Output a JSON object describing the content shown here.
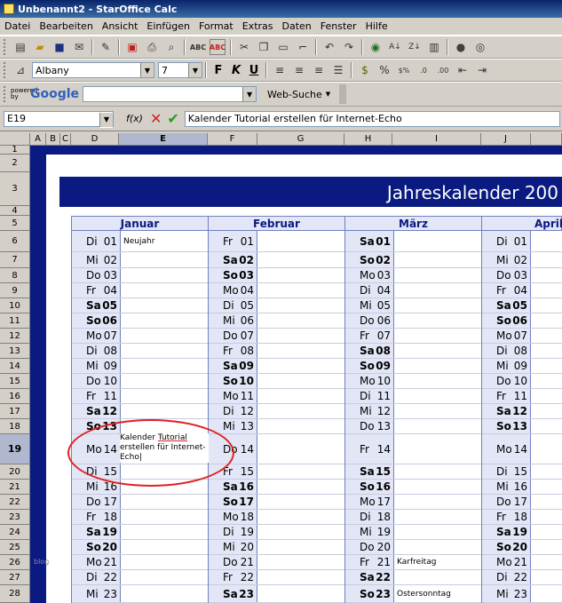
{
  "window": {
    "title": "Unbenannt2 - StarOffice Calc"
  },
  "menu": [
    "Datei",
    "Bearbeiten",
    "Ansicht",
    "Einfügen",
    "Format",
    "Extras",
    "Daten",
    "Fenster",
    "Hilfe"
  ],
  "font": {
    "name": "Albany",
    "size": "7"
  },
  "google": {
    "powered": "powered by",
    "logo": "Google",
    "search_value": "",
    "search_button": "Web-Suche"
  },
  "formula": {
    "namebox": "E19",
    "fx": "f(x)",
    "content": "Kalender Tutorial erstellen für Internet-Echo"
  },
  "columns": [
    "A",
    "B",
    "C",
    "D",
    "E",
    "F",
    "G",
    "H",
    "I",
    "J"
  ],
  "rows": [
    "1",
    "2",
    "3",
    "4",
    "5",
    "6",
    "7",
    "8",
    "9",
    "10",
    "11",
    "12",
    "13",
    "14",
    "15",
    "16",
    "17",
    "18",
    "19",
    "20",
    "21",
    "22",
    "23",
    "24",
    "25",
    "26",
    "27",
    "28"
  ],
  "calendar": {
    "title": "Jahreskalender 200",
    "months": [
      "Januar",
      "Februar",
      "März",
      "April"
    ],
    "januar": [
      [
        "Di",
        "01",
        "Neujahr"
      ],
      [
        "Mi",
        "02",
        ""
      ],
      [
        "Do",
        "03",
        ""
      ],
      [
        "Fr",
        "04",
        ""
      ],
      [
        "Sa",
        "05",
        ""
      ],
      [
        "So",
        "06",
        ""
      ],
      [
        "Mo",
        "07",
        ""
      ],
      [
        "Di",
        "08",
        ""
      ],
      [
        "Mi",
        "09",
        ""
      ],
      [
        "Do",
        "10",
        ""
      ],
      [
        "Fr",
        "11",
        ""
      ],
      [
        "Sa",
        "12",
        ""
      ],
      [
        "So",
        "13",
        ""
      ],
      [
        "Mo",
        "14",
        ""
      ],
      [
        "Di",
        "15",
        ""
      ],
      [
        "Mi",
        "16",
        ""
      ],
      [
        "Do",
        "17",
        ""
      ],
      [
        "Fr",
        "18",
        ""
      ],
      [
        "Sa",
        "19",
        ""
      ],
      [
        "So",
        "20",
        ""
      ],
      [
        "Mo",
        "21",
        ""
      ],
      [
        "Di",
        "22",
        ""
      ],
      [
        "Mi",
        "23",
        ""
      ]
    ],
    "februar": [
      [
        "Fr",
        "01",
        ""
      ],
      [
        "Sa",
        "02",
        ""
      ],
      [
        "So",
        "03",
        ""
      ],
      [
        "Mo",
        "04",
        ""
      ],
      [
        "Di",
        "05",
        ""
      ],
      [
        "Mi",
        "06",
        ""
      ],
      [
        "Do",
        "07",
        ""
      ],
      [
        "Fr",
        "08",
        ""
      ],
      [
        "Sa",
        "09",
        ""
      ],
      [
        "So",
        "10",
        ""
      ],
      [
        "Mo",
        "11",
        ""
      ],
      [
        "Di",
        "12",
        ""
      ],
      [
        "Mi",
        "13",
        ""
      ],
      [
        "Do",
        "14",
        ""
      ],
      [
        "Fr",
        "15",
        ""
      ],
      [
        "Sa",
        "16",
        ""
      ],
      [
        "So",
        "17",
        ""
      ],
      [
        "Mo",
        "18",
        ""
      ],
      [
        "Di",
        "19",
        ""
      ],
      [
        "Mi",
        "20",
        ""
      ],
      [
        "Do",
        "21",
        ""
      ],
      [
        "Fr",
        "22",
        ""
      ],
      [
        "Sa",
        "23",
        ""
      ]
    ],
    "maerz": [
      [
        "Sa",
        "01",
        ""
      ],
      [
        "So",
        "02",
        ""
      ],
      [
        "Mo",
        "03",
        ""
      ],
      [
        "Di",
        "04",
        ""
      ],
      [
        "Mi",
        "05",
        ""
      ],
      [
        "Do",
        "06",
        ""
      ],
      [
        "Fr",
        "07",
        ""
      ],
      [
        "Sa",
        "08",
        ""
      ],
      [
        "So",
        "09",
        ""
      ],
      [
        "Mo",
        "10",
        ""
      ],
      [
        "Di",
        "11",
        ""
      ],
      [
        "Mi",
        "12",
        ""
      ],
      [
        "Do",
        "13",
        ""
      ],
      [
        "Fr",
        "14",
        ""
      ],
      [
        "Sa",
        "15",
        ""
      ],
      [
        "So",
        "16",
        ""
      ],
      [
        "Mo",
        "17",
        ""
      ],
      [
        "Di",
        "18",
        ""
      ],
      [
        "Mi",
        "19",
        ""
      ],
      [
        "Do",
        "20",
        ""
      ],
      [
        "Fr",
        "21",
        "Karfreitag"
      ],
      [
        "Sa",
        "22",
        ""
      ],
      [
        "So",
        "23",
        "Ostersonntag"
      ]
    ],
    "april": [
      [
        "Di",
        "01",
        ""
      ],
      [
        "Mi",
        "02",
        ""
      ],
      [
        "Do",
        "03",
        ""
      ],
      [
        "Fr",
        "04",
        ""
      ],
      [
        "Sa",
        "05",
        ""
      ],
      [
        "So",
        "06",
        ""
      ],
      [
        "Mo",
        "07",
        ""
      ],
      [
        "Di",
        "08",
        ""
      ],
      [
        "Mi",
        "09",
        ""
      ],
      [
        "Do",
        "10",
        ""
      ],
      [
        "Fr",
        "11",
        ""
      ],
      [
        "Sa",
        "12",
        ""
      ],
      [
        "So",
        "13",
        ""
      ],
      [
        "Mo",
        "14",
        ""
      ],
      [
        "Di",
        "15",
        ""
      ],
      [
        "Mi",
        "16",
        ""
      ],
      [
        "Do",
        "17",
        ""
      ],
      [
        "Fr",
        "18",
        ""
      ],
      [
        "Sa",
        "19",
        ""
      ],
      [
        "So",
        "20",
        ""
      ],
      [
        "Mo",
        "21",
        ""
      ],
      [
        "Di",
        "22",
        ""
      ],
      [
        "Mi",
        "23",
        ""
      ]
    ],
    "editing_note": [
      "Kalender ",
      "Tutorial",
      " erstellen für Internet-Echo"
    ]
  },
  "watermark": "blog",
  "colors": {
    "navy": "#0a1a80",
    "header_fill": "#e2e6f6",
    "highlight": "#e02020"
  }
}
